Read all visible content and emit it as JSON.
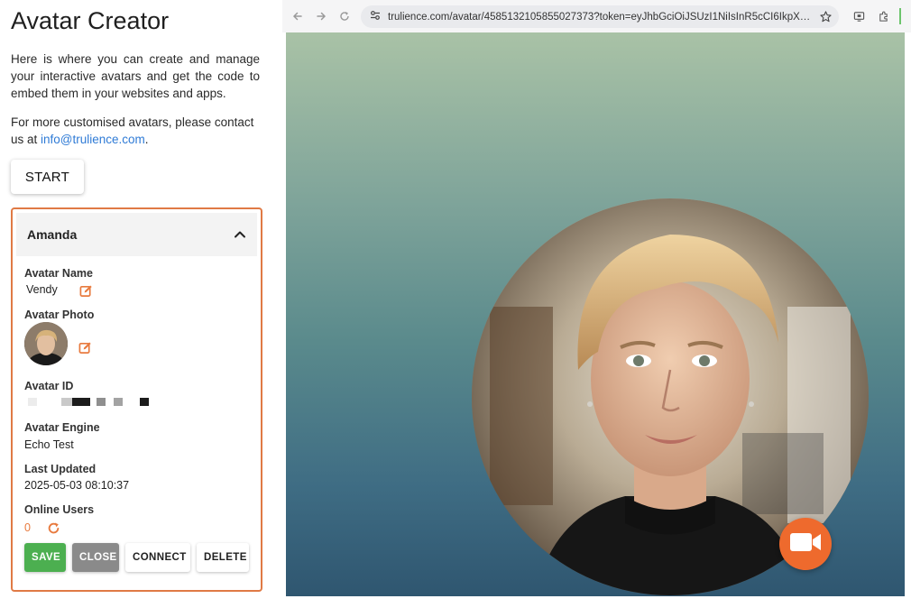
{
  "page": {
    "title": "Avatar Creator",
    "intro": "Here is where you can create and manage your interactive avatars and get the code to embed them in your websites and apps.",
    "contact_prefix": "For more customised avatars, please contact us at ",
    "contact_email": "info@trulience.com",
    "contact_suffix": ".",
    "start_label": "START"
  },
  "card": {
    "header_name": "Amanda",
    "labels": {
      "avatar_name": "Avatar Name",
      "avatar_photo": "Avatar Photo",
      "avatar_id": "Avatar ID",
      "avatar_engine": "Avatar Engine",
      "last_updated": "Last Updated",
      "online_users": "Online Users"
    },
    "values": {
      "avatar_name": "Vendy",
      "avatar_engine": "Echo Test",
      "last_updated": "2025-05-03 08:10:37",
      "online_users": "0"
    },
    "buttons": {
      "save": "SAVE",
      "close": "CLOSE",
      "connect": "CONNECT",
      "delete": "DELETE"
    },
    "colors": {
      "border": "#e07a45",
      "accent": "#e87a3e",
      "save": "#4caf50",
      "close": "#8a8a8a"
    }
  },
  "browser": {
    "url": "trulience.com/avatar/4585132105855027373?token=eyJhbGciOiJSUzI1NiIsInR5cCI6IkpXVCJ9..."
  }
}
